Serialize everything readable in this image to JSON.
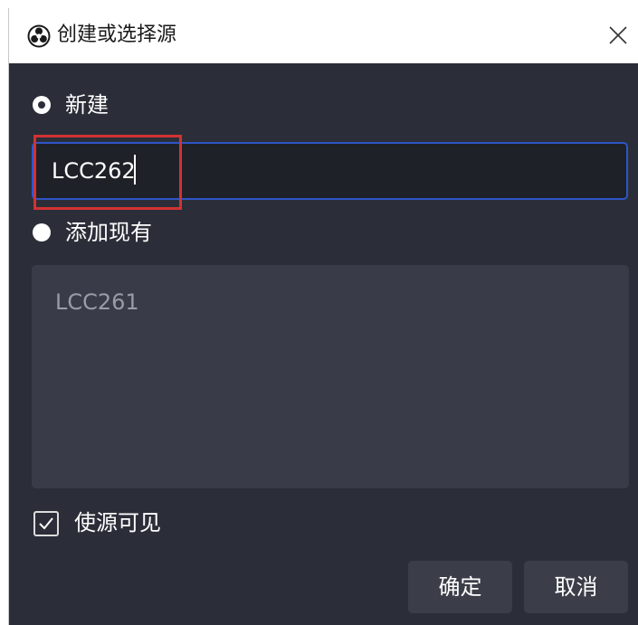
{
  "window": {
    "title": "创建或选择源",
    "app_icon": "obs-icon",
    "close_icon": "close-icon"
  },
  "create_new": {
    "label": "新建",
    "selected": true,
    "input_value": "LCC262"
  },
  "add_existing": {
    "label": "添加现有",
    "selected": false,
    "items": [
      "LCC261"
    ]
  },
  "visibility": {
    "label": "使源可见",
    "checked": true
  },
  "buttons": {
    "ok": "确定",
    "cancel": "取消"
  },
  "colors": {
    "dialog_bg": "#2b2e38",
    "input_border": "#2e55c8",
    "highlight_annotation": "#d23232",
    "button_bg": "#3b3e48"
  }
}
